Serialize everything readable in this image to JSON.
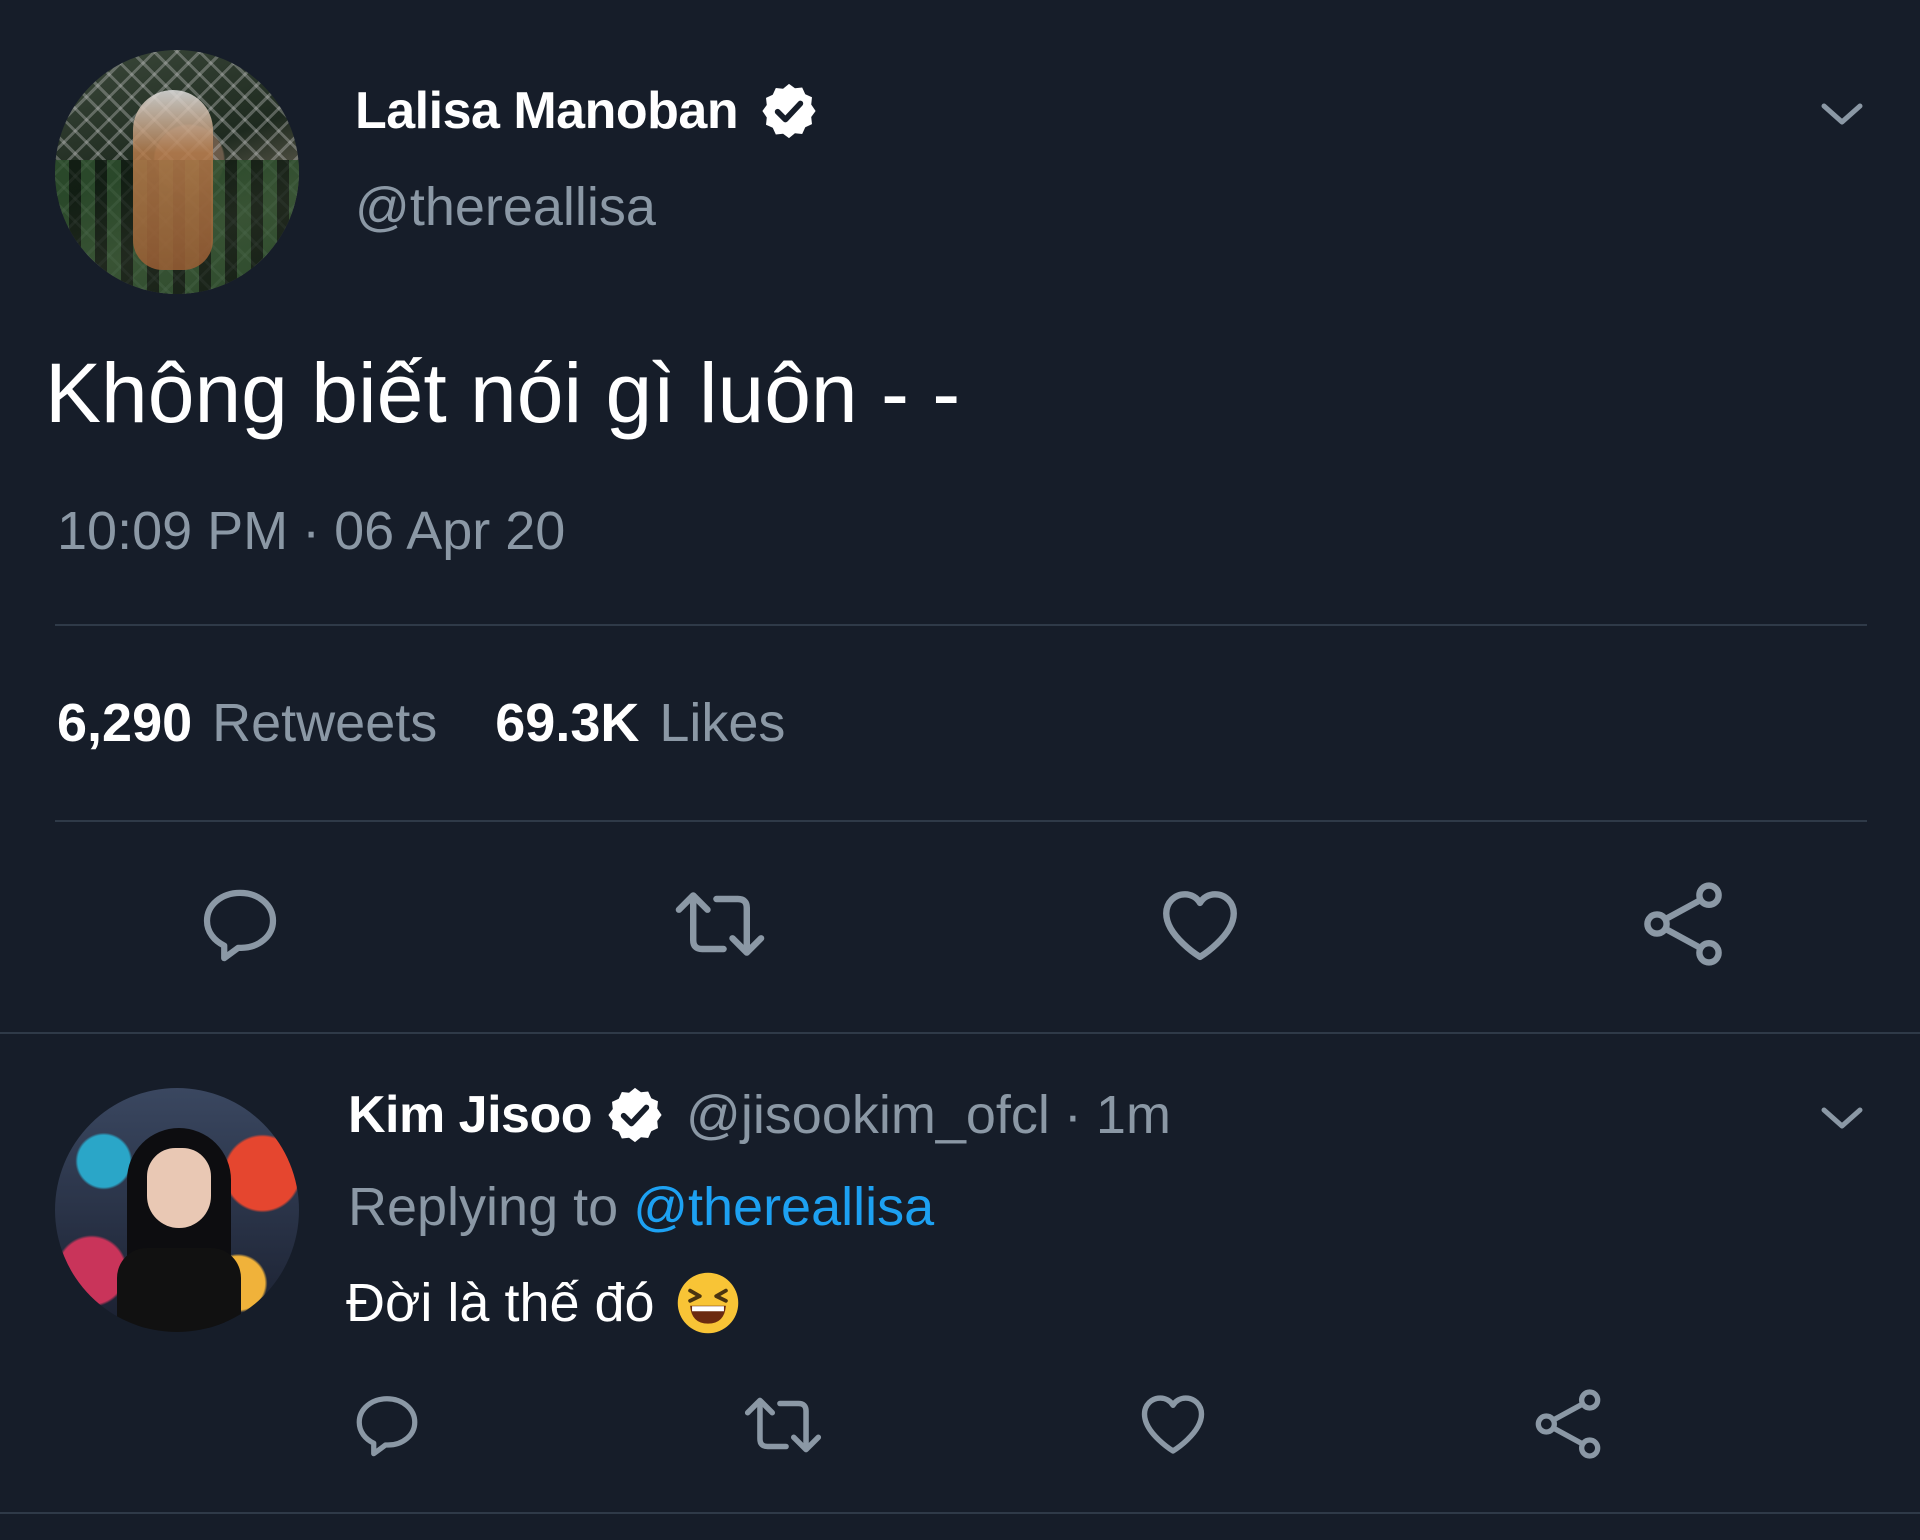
{
  "tweet": {
    "author_name": "Lalisa Manoban",
    "author_handle": "@thereallisa",
    "text": "Không biết nói gì luôn - -",
    "time": "10:09 PM",
    "separator": "·",
    "date": "06 Apr 20",
    "retweets_count": "6,290",
    "retweets_label": "Retweets",
    "likes_count": "69.3K",
    "likes_label": "Likes"
  },
  "reply": {
    "author_name": "Kim Jisoo",
    "author_handle": "@jisookim_ofcl",
    "separator": "·",
    "age": "1m",
    "replying_label": "Replying to",
    "replying_handle": "@thereallisa",
    "text": "Đời là thế đó",
    "emoji": "😆"
  },
  "colors": {
    "background": "#161d29",
    "text": "#ffffff",
    "muted": "#8b98a5",
    "link": "#1da1f2",
    "divider": "#2f3a48"
  },
  "icons": [
    "verified-badge-icon",
    "chevron-down-icon",
    "reply-icon",
    "retweet-icon",
    "like-icon",
    "share-icon"
  ]
}
